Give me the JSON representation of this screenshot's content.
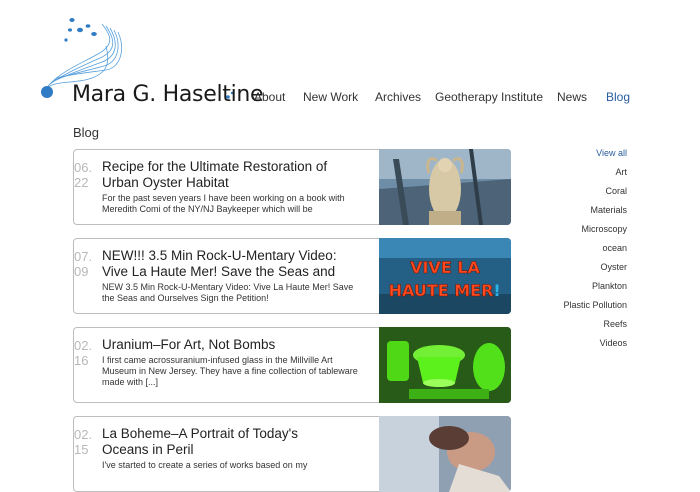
{
  "site": {
    "title": "Mara G. Haseltine"
  },
  "nav": [
    {
      "label": "About",
      "active": false
    },
    {
      "label": "New Work",
      "active": false
    },
    {
      "label": "Archives",
      "active": false
    },
    {
      "label": "Geotherapy Institute",
      "active": false
    },
    {
      "label": "News",
      "active": false
    },
    {
      "label": "Blog",
      "active": true
    }
  ],
  "page": {
    "title": "Blog"
  },
  "posts": [
    {
      "month": "06.",
      "year": "22",
      "title": "Recipe for the Ultimate Restoration of Urban Oyster Habitat",
      "excerpt": "For the past seven years I have been working on a book with Meredith Comi of the NY/NJ Baykeeper which will be",
      "thumb": "sculpture-icon"
    },
    {
      "month": "07.",
      "year": "09",
      "title": "NEW!!! 3.5 Min Rock-U-Mentary Video: Vive La Haute Mer! Save the Seas and",
      "excerpt": "NEW 3.5 Min Rock-U-Mentary Video: Vive La Haute Mer! Save the Seas and Ourselves Sign the Petition!",
      "thumb": "vive-la-haute-mer-image",
      "thumb_text_1": "VIVE LA",
      "thumb_text_2": "HAUTE MER",
      "thumb_text_3": "!"
    },
    {
      "month": "02.",
      "year": "16",
      "title": "Uranium–For Art, Not Bombs",
      "excerpt": "I first came acrossuranium-infused glass in the Millville Art Museum in New Jersey. They have a fine collection of tableware made with [...]",
      "thumb": "uranium-glass-image"
    },
    {
      "month": "02.",
      "year": "15",
      "title": "La Boheme–A Portrait of Today's Oceans in Peril",
      "excerpt": "I've started to create a series of works based on my",
      "thumb": "la-boheme-image"
    }
  ],
  "sidebar": {
    "categories": [
      {
        "label": "View all",
        "active": true
      },
      {
        "label": "Art",
        "active": false
      },
      {
        "label": "Coral",
        "active": false
      },
      {
        "label": "Materials",
        "active": false
      },
      {
        "label": "Microscopy",
        "active": false
      },
      {
        "label": "ocean",
        "active": false
      },
      {
        "label": "Oyster",
        "active": false
      },
      {
        "label": "Plankton",
        "active": false
      },
      {
        "label": "Plastic Pollution",
        "active": false
      },
      {
        "label": "Reefs",
        "active": false
      },
      {
        "label": "Videos",
        "active": false
      }
    ]
  },
  "colors": {
    "accent": "#2a5d9f",
    "date": "#b8b8b8",
    "logo": "#3a8fd6"
  }
}
